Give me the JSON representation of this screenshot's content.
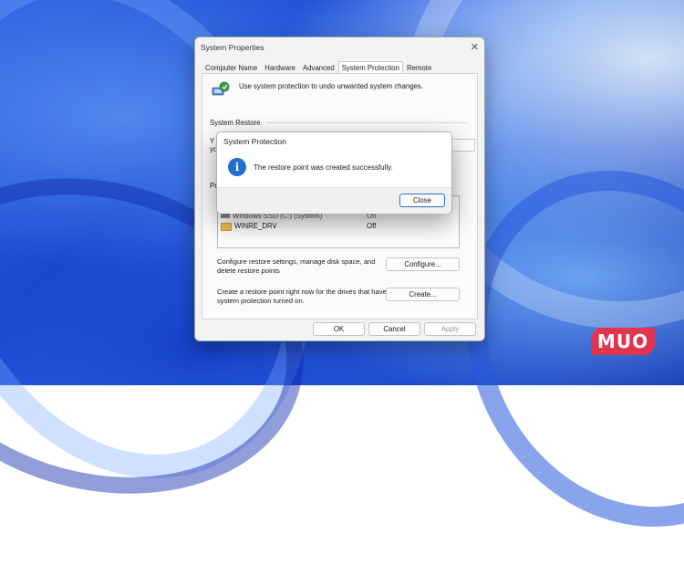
{
  "window": {
    "title": "System Properties",
    "tabs": [
      "Computer Name",
      "Hardware",
      "Advanced",
      "System Protection",
      "Remote"
    ],
    "active_tab": "System Protection",
    "intro_text": "Use system protection to undo unwanted system changes.",
    "system_restore_heading": "System Restore",
    "partial_text_1": "Y",
    "partial_text_2": "yo",
    "protection_heading_partial": "Pro",
    "drives": [
      {
        "name": "Windows SSD (C:) (System)",
        "status": "On",
        "icon": "drive-icon"
      },
      {
        "name": "WINRE_DRV",
        "status": "Off",
        "icon": "folder-icon"
      }
    ],
    "configure_desc": "Configure restore settings, manage disk space, and delete restore points",
    "configure_button": "Configure...",
    "create_desc": "Create a restore point right now for the drives that have system protection turned on.",
    "create_button": "Create...",
    "ok_button": "OK",
    "cancel_button": "Cancel",
    "apply_button": "Apply"
  },
  "modal": {
    "title": "System Protection",
    "icon": "info-icon",
    "message": "The restore point was created successfully.",
    "close_button": "Close"
  },
  "logo": {
    "text": "MUO",
    "color": "#e0344f"
  },
  "colors": {
    "accent": "#1f6fcf",
    "dialog_bg": "#f3f3f3"
  }
}
